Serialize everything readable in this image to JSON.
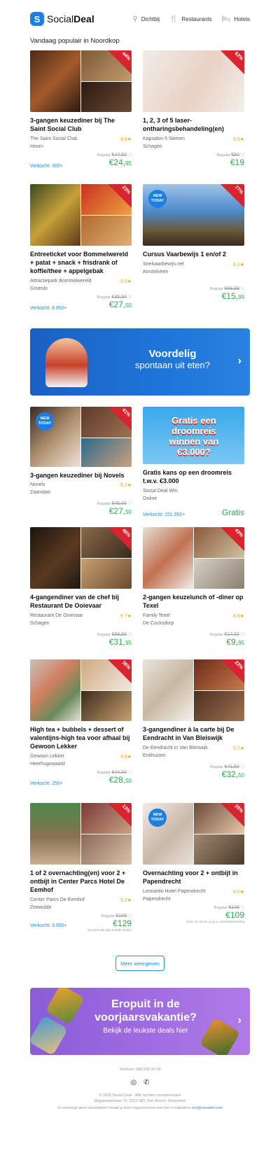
{
  "header": {
    "brand_light": "Social",
    "brand_bold": "Deal",
    "nav": [
      {
        "label": "Dichtbij",
        "icon": "location-pin-icon"
      },
      {
        "label": "Restaurants",
        "icon": "cutlery-icon"
      },
      {
        "label": "Hotels",
        "icon": "bed-icon"
      }
    ]
  },
  "section_title": "Vandaag populair in Noordkop",
  "deals": [
    {
      "title": "3-gangen keuzediner bij The Saint Social Club",
      "vendor": "The Saint Social Club",
      "rating": "9.6★",
      "location": "Hoorn",
      "sold": "Verkocht: 300+",
      "regular_label": "Regular",
      "regular_price": "€44,50",
      "price_main": "€24,",
      "price_cents": "95",
      "discount": "44%",
      "new": false
    },
    {
      "title": "1, 2, 3 of 5 laser-ontharingsbehandeling(en)",
      "vendor": "Kapsalon 5 Sterren",
      "rating": "8.8★",
      "location": "Schagen",
      "sold": "",
      "regular_label": "Regular",
      "regular_price": "€50",
      "price_main": "€19",
      "price_cents": "",
      "discount": "62%",
      "new": false
    },
    {
      "title": "Entreeticket voor Bommelwereld + patat + snack + frisdrank of koffie/thee + appelgebak",
      "vendor": "Attractiepark Bommelwereld",
      "rating": "9.5★",
      "location": "Groenlo",
      "sold": "Verkocht: 8.850+",
      "regular_label": "Regular",
      "regular_price": "€35,50",
      "price_main": "€27,",
      "price_cents": "50",
      "discount": "23%",
      "new": false
    },
    {
      "title": "Cursus Vaarbewijs 1 en/of 2",
      "vendor": "Snelvaarbewijs.net",
      "rating": "8.1★",
      "location": "Amstelveen",
      "sold": "",
      "regular_label": "Regular",
      "regular_price": "€69,99",
      "price_main": "€15,",
      "price_cents": "99",
      "discount": "77%",
      "new": true
    },
    {
      "title": "3-gangen keuzediner bij Novels",
      "vendor": "Novels",
      "rating": "9.1★",
      "location": "Zaandam",
      "sold": "",
      "regular_label": "Regular",
      "regular_price": "€46,65",
      "price_main": "€27,",
      "price_cents": "50",
      "discount": "41%",
      "new": true
    },
    {
      "title": "Gratis kans op een droomreis t.w.v. €3.000",
      "vendor": "Social Deal Win",
      "rating": "",
      "location": "Online",
      "sold": "Verkocht: 151.950+",
      "regular_label": "",
      "regular_price": "",
      "price_main": "Gratis",
      "price_cents": "",
      "discount": "",
      "new": false,
      "promo_text": "Gratis een droomreis winnen van €3.000?"
    },
    {
      "title": "4-gangendiner van de chef bij Restaurant De Ooievaar",
      "vendor": "Restaurant De Ooievaar",
      "rating": "9.7★",
      "location": "Schagen",
      "sold": "",
      "regular_label": "Regular",
      "regular_price": "€59,50",
      "price_main": "€31,",
      "price_cents": "95",
      "discount": "46%",
      "new": false
    },
    {
      "title": "2-gangen keuzelunch of -diner op Texel",
      "vendor": "Family Texel",
      "rating": "8.8★",
      "location": "De Cocksdorp",
      "sold": "",
      "regular_label": "Regular",
      "regular_price": "€17,50",
      "price_main": "€9,",
      "price_cents": "95",
      "discount": "43%",
      "new": false
    },
    {
      "title": "High tea + bubbels + dessert of valentijns-high tea voor afhaal bij Gewoon Lekker",
      "vendor": "Gewoon Lekker",
      "rating": "9.6★",
      "location": "Heerhugowaard",
      "sold": "Verkocht: 250+",
      "regular_label": "Regular",
      "regular_price": "€44,50",
      "price_main": "€28,",
      "price_cents": "50",
      "discount": "36%",
      "new": false
    },
    {
      "title": "3-gangendiner à la carte bij De Eendracht in Van Bleiswijk",
      "vendor": "De Eendracht in Van Bleiswijk",
      "rating": "9.7★",
      "location": "Enkhuizen",
      "sold": "",
      "regular_label": "Regular",
      "regular_price": "€41,50",
      "price_main": "€32,",
      "price_cents": "50",
      "discount": "22%",
      "new": false
    },
    {
      "title": "1 of 2 overnachting(en) voor 2 + ontbijt in Center Parcs Hotel De Eemhof",
      "vendor": "Center Parcs De Eemhof",
      "rating": "9.2★",
      "location": "Zeewolde",
      "sold": "Verkocht: 3.950+",
      "regular_label": "Regular",
      "regular_price": "€148",
      "price_main": "€129",
      "price_cents": "",
      "discount": "13%",
      "new": false,
      "note": "Inclusief alle bijkomende kosten"
    },
    {
      "title": "Overnachting voor 2 + ontbijt in Papendrecht",
      "vendor": "Leonardo Hotel Papendrecht",
      "rating": "9.0★",
      "location": "Papendrecht",
      "sold": "",
      "regular_label": "Regular",
      "regular_price": "€148",
      "price_main": "€109",
      "price_cents": "",
      "discount": "26%",
      "new": true,
      "note": "Excl. ca. €2,34 p.p.p.n. toeristenbelasting"
    }
  ],
  "new_label_1": "NEW",
  "new_label_2": "TODAY",
  "banner1": {
    "line1": "Voordelig",
    "line2": "spontaan uit eten?"
  },
  "banner2": {
    "line1": "Eropuit in de voorjaarsvakantie?",
    "line2": "Bekijk de leukste deals hier"
  },
  "more_button": "Meer weergeven",
  "footer": {
    "phone": "Telefoon: 088-205 05 05",
    "copyright": "© 2026 Social Deal - Alle rechten voorbehouden",
    "address": "Magistratenlaan 72, 5223 MD, Den Bosch, Nederland",
    "notice": "Je ontvangt deze nieuwsbrief omdat je bent ingeschreven met het e-mailadres",
    "email": "xxx@ureader.com"
  },
  "colors": {
    "accent": "#1a8fe0",
    "price_green": "#27ae4a",
    "discount_red": "#d9232e",
    "rating_orange": "#f2a500"
  }
}
